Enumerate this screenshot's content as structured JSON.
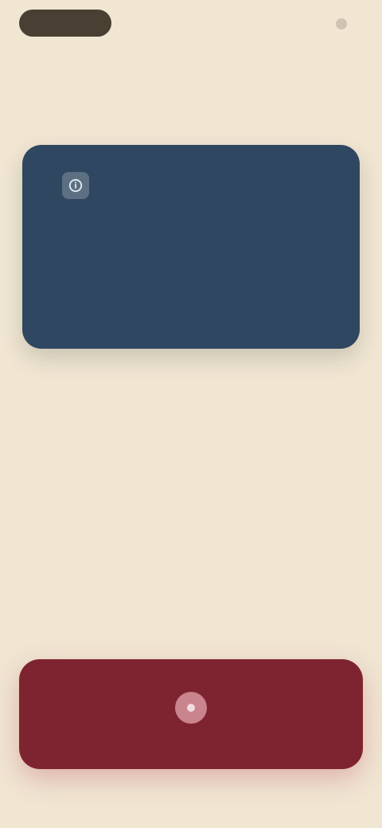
{
  "header": {
    "pill_label": "",
    "right_label": ""
  },
  "card": {
    "icon": "info-icon",
    "title": "",
    "body": ""
  },
  "action": {
    "icon": "record-icon",
    "label": ""
  },
  "colors": {
    "background": "#F0E6D2",
    "card": "#2F4760",
    "action": "#7E2430",
    "pill": "#4A3F33"
  }
}
